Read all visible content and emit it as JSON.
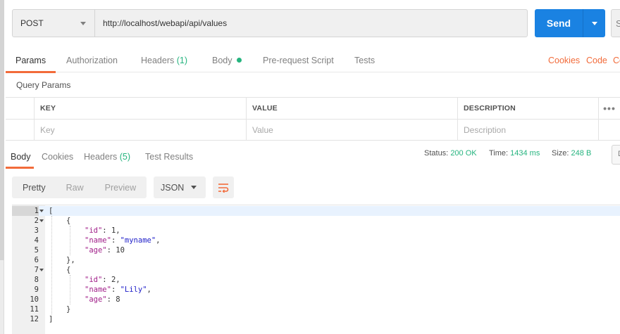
{
  "request": {
    "method": "POST",
    "url": "http://localhost/webapi/api/values",
    "send_label": "Send",
    "save_stub": "S"
  },
  "request_tabs": {
    "params": "Params",
    "authorization": "Authorization",
    "headers": "Headers",
    "headers_count": "(1)",
    "body": "Body",
    "prerequest": "Pre-request Script",
    "tests": "Tests",
    "cookies": "Cookies",
    "code": "Code",
    "comments_stub": "Co"
  },
  "query_params": {
    "title": "Query Params",
    "columns": {
      "key": "KEY",
      "value": "VALUE",
      "description": "DESCRIPTION"
    },
    "placeholders": {
      "key": "Key",
      "value": "Value",
      "description": "Description"
    },
    "more": "•••"
  },
  "response_tabs": {
    "body": "Body",
    "cookies": "Cookies",
    "headers": "Headers",
    "headers_count": "(5)",
    "test_results": "Test Results"
  },
  "response_status": {
    "status_label": "Status:",
    "status_value": "200 OK",
    "time_label": "Time:",
    "time_value": "1434 ms",
    "size_label": "Size:",
    "size_value": "248 B",
    "stub": "D"
  },
  "format_toolbar": {
    "pretty": "Pretty",
    "raw": "Raw",
    "preview": "Preview",
    "language": "JSON"
  },
  "response_body": {
    "line_numbers": [
      "1",
      "2",
      "3",
      "4",
      "5",
      "6",
      "7",
      "8",
      "9",
      "10",
      "11",
      "12"
    ],
    "items": [
      {
        "id": "1",
        "name": "\"myname\"",
        "age": "10"
      },
      {
        "id": "2",
        "name": "\"Lily\"",
        "age": "8"
      }
    ],
    "keys": {
      "id": "\"id\"",
      "name": "\"name\"",
      "age": "\"age\""
    },
    "punct": {
      "open_bracket": "[",
      "close_bracket": "]",
      "open_brace": "{",
      "close_brace": "}",
      "close_brace_comma": "},"
    }
  },
  "colors": {
    "accent": "#f26b3a",
    "send": "#1a82e2",
    "success": "#26b47f",
    "json_key": "#a1218a",
    "json_string": "#2121c9"
  }
}
